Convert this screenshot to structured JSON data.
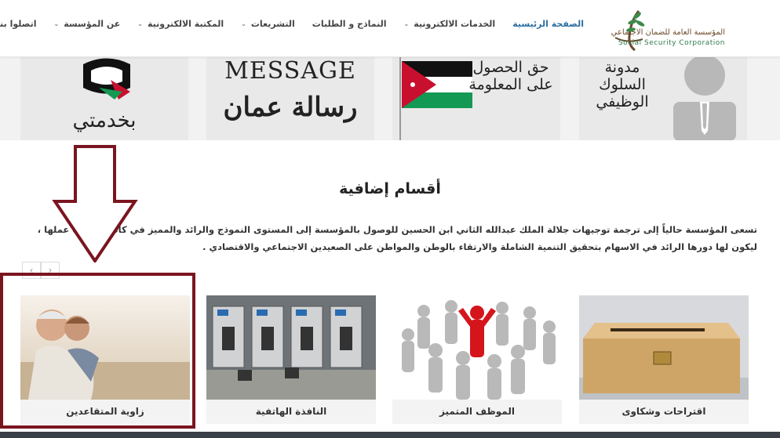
{
  "header": {
    "logo_ar": "المؤسسة العامة للضمان الاجتماعي",
    "logo_en": "Social Security Corporation",
    "nav": [
      {
        "label": "الصفحة الرئيسية",
        "active": true,
        "dropdown": false
      },
      {
        "label": "الخدمات الالكترونية",
        "active": false,
        "dropdown": true
      },
      {
        "label": "النماذج و الطلبات",
        "active": false,
        "dropdown": false
      },
      {
        "label": "التشريعات",
        "active": false,
        "dropdown": true
      },
      {
        "label": "المكتبة الالكترونية",
        "active": false,
        "dropdown": true
      },
      {
        "label": "عن المؤسسة",
        "active": false,
        "dropdown": true
      },
      {
        "label": "اتصلوا بنا",
        "active": false,
        "dropdown": true
      }
    ]
  },
  "banners": {
    "b1_text": "بخدمتي",
    "b2_en": "MESSAGE",
    "b2_ar": "رسالة عمان",
    "b3_text": "حق الحصول على المعلومة",
    "b4_text": "مدونة السلوك الوظيفي"
  },
  "section": {
    "title": "أقسام إضافية",
    "description": "تسعى المؤسسة حالياً إلى ترجمة توجيهات جلالة الملك عبدالله الثاني ابن الحسين للوصول بالمؤسسة إلى المستوى النموذج والرائد والمميز في كافة مجالات عملها ، ليكون لها دورها الرائد في الاسهام بتحقيق التنمية الشاملة والارتقاء بالوطن والمواطن على الصعيدين الاجتماعي والاقتصادي ."
  },
  "cards": [
    {
      "label": "زاوية المتقاعدين"
    },
    {
      "label": "النافذة الهاتفية"
    },
    {
      "label": "الموظف المتميز"
    },
    {
      "label": "اقتراحات وشكاوى"
    }
  ],
  "colors": {
    "accent_nav": "#2c6fa3",
    "highlight": "#7a1520"
  }
}
